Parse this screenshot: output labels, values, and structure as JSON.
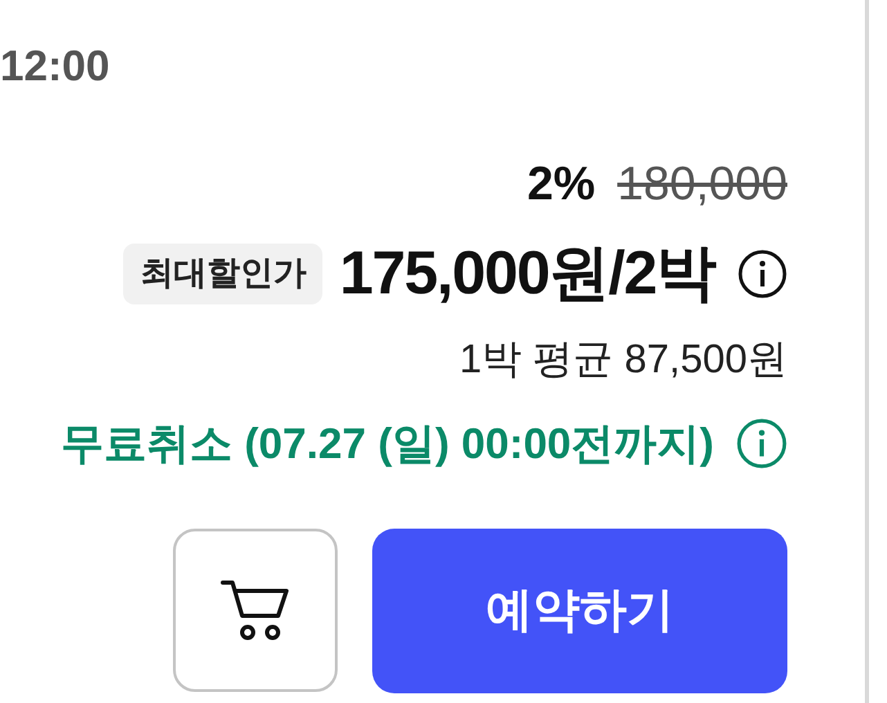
{
  "time": "12:00",
  "price": {
    "discount_rate": "2%",
    "original_price": "180,000",
    "badge": "최대할인가",
    "total": "175,000원/2박",
    "per_night": "1박 평균 87,500원"
  },
  "cancellation": {
    "text": "무료취소 (07.27 (일) 00:00전까지)"
  },
  "buttons": {
    "reserve": "예약하기"
  }
}
